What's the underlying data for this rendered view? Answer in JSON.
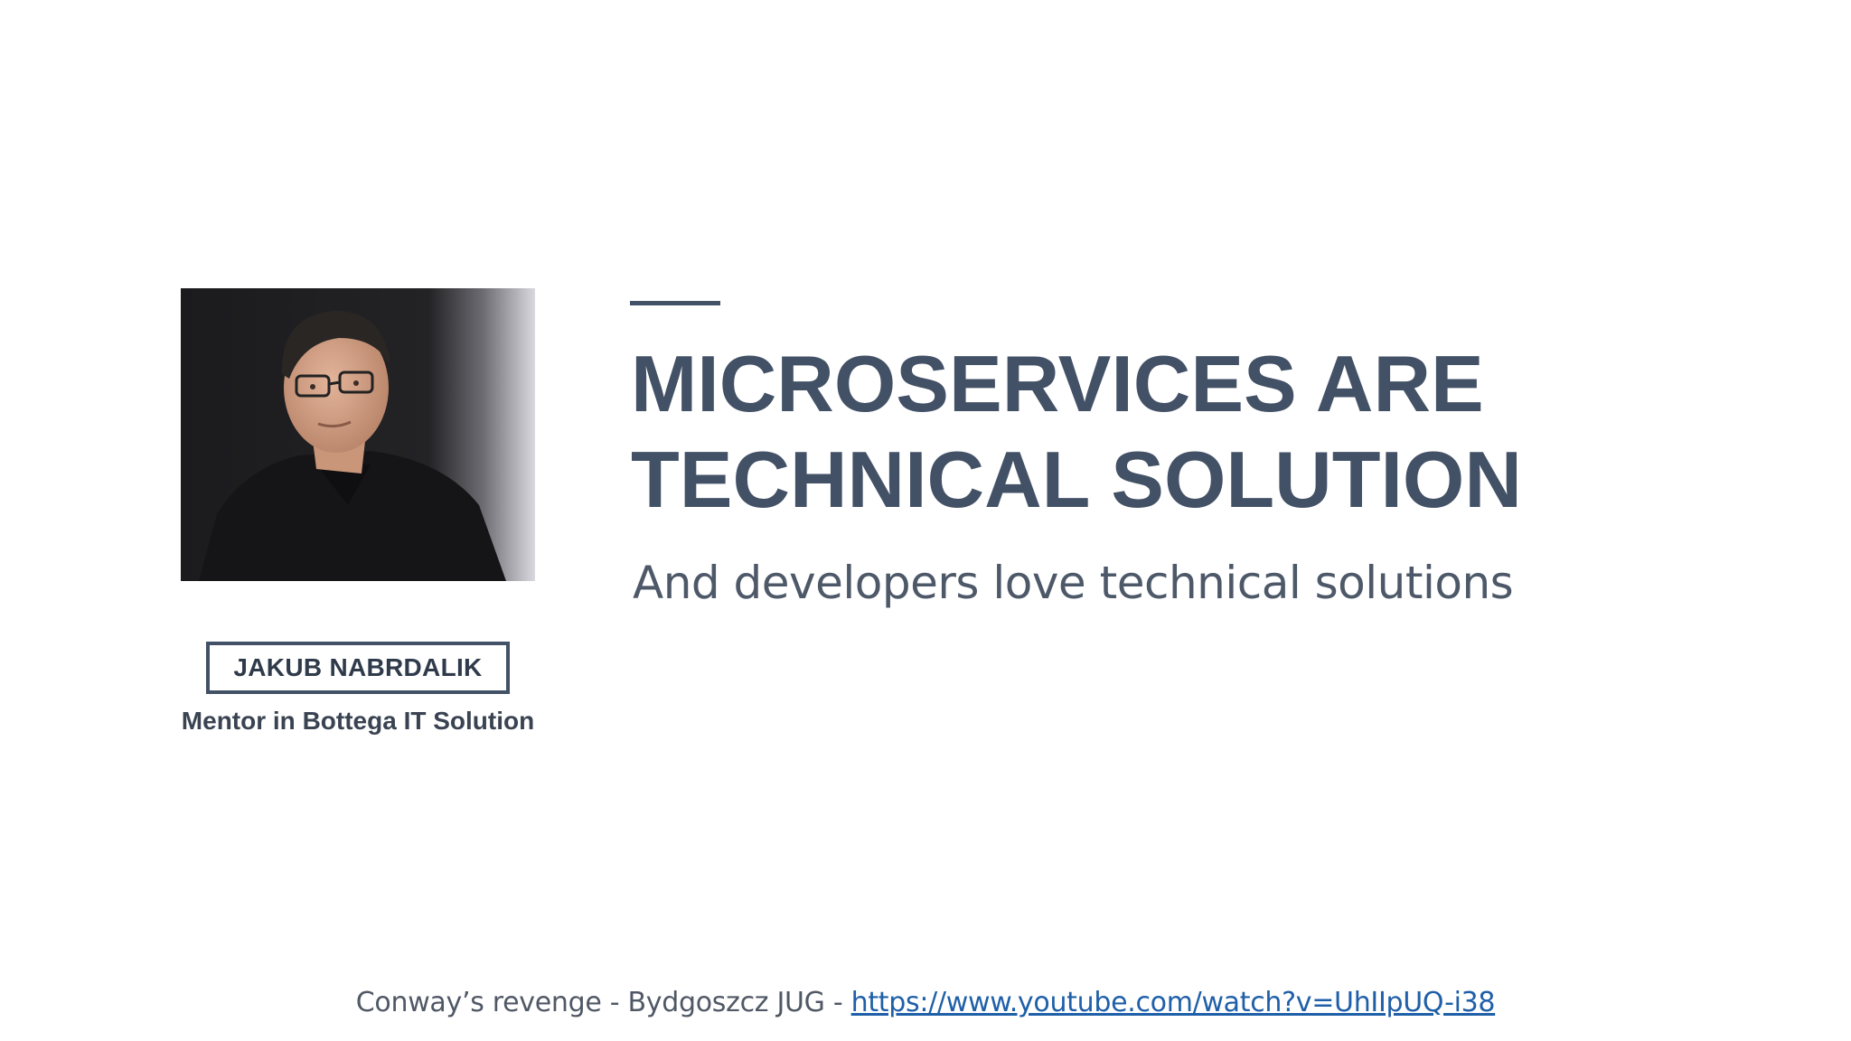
{
  "slide": {
    "title_line1": "MICROSERVICES ARE",
    "title_line2": "TECHNICAL SOLUTION",
    "subtitle": "And developers love technical solutions"
  },
  "speaker": {
    "name": "JAKUB NABRDALIK",
    "role": "Mentor in Bottega IT Solution"
  },
  "footer": {
    "text": "Conway’s revenge - Bydgoszcz JUG - ",
    "link_text": "https://www.youtube.com/watch?v=UhIIpUQ-i38"
  },
  "colors": {
    "title": "#435166",
    "link": "#1f5fa8"
  }
}
